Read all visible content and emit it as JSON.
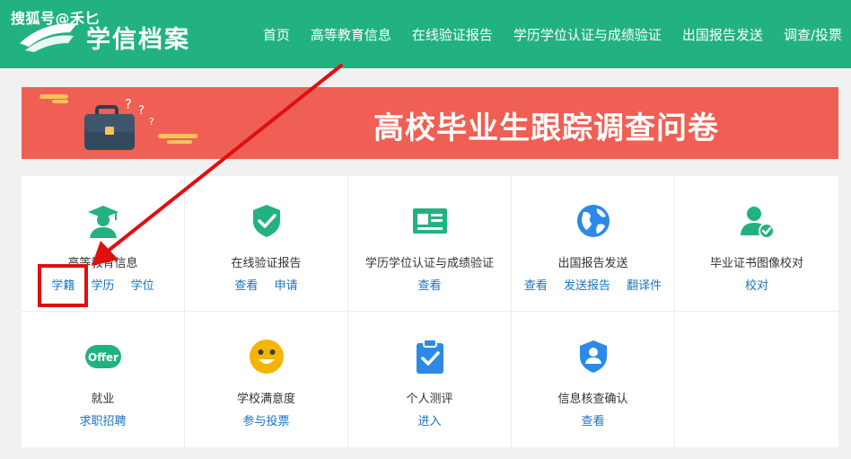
{
  "watermark": "搜狐号@禾匕",
  "logo": {
    "text": "学信档案"
  },
  "nav": [
    {
      "label": "首页"
    },
    {
      "label": "高等教育信息"
    },
    {
      "label": "在线验证报告"
    },
    {
      "label": "学历学位认证与成绩验证"
    },
    {
      "label": "出国报告发送"
    },
    {
      "label": "调查/投票"
    }
  ],
  "banner": {
    "title": "高校毕业生跟踪调查问卷"
  },
  "services": [
    {
      "title": "高等教育信息",
      "icon": "graduate-icon",
      "links": [
        "学籍",
        "学历",
        "学位"
      ]
    },
    {
      "title": "在线验证报告",
      "icon": "shield-check-icon",
      "links": [
        "查看",
        "申请"
      ]
    },
    {
      "title": "学历学位认证与成绩验证",
      "icon": "certificate-card-icon",
      "links": [
        "查看"
      ]
    },
    {
      "title": "出国报告发送",
      "icon": "globe-icon",
      "links": [
        "查看",
        "发送报告",
        "翻译件"
      ]
    },
    {
      "title": "毕业证书图像校对",
      "icon": "user-check-icon",
      "links": [
        "校对"
      ]
    },
    {
      "title": "就业",
      "icon": "offer-icon",
      "icon_text": "Offer",
      "links": [
        "求职招聘"
      ]
    },
    {
      "title": "学校满意度",
      "icon": "smiley-icon",
      "links": [
        "参与投票"
      ]
    },
    {
      "title": "个人测评",
      "icon": "clipboard-check-icon",
      "links": [
        "进入"
      ]
    },
    {
      "title": "信息核查确认",
      "icon": "shield-user-icon",
      "links": [
        "查看"
      ]
    }
  ],
  "colors": {
    "header": "#22b27f",
    "banner": "#ef5f53",
    "link": "#1a73c0",
    "icon_green": "#22b27f",
    "icon_blue": "#2c8ae6",
    "icon_yellow": "#f4b400",
    "annotation_red": "#e00f0f"
  }
}
